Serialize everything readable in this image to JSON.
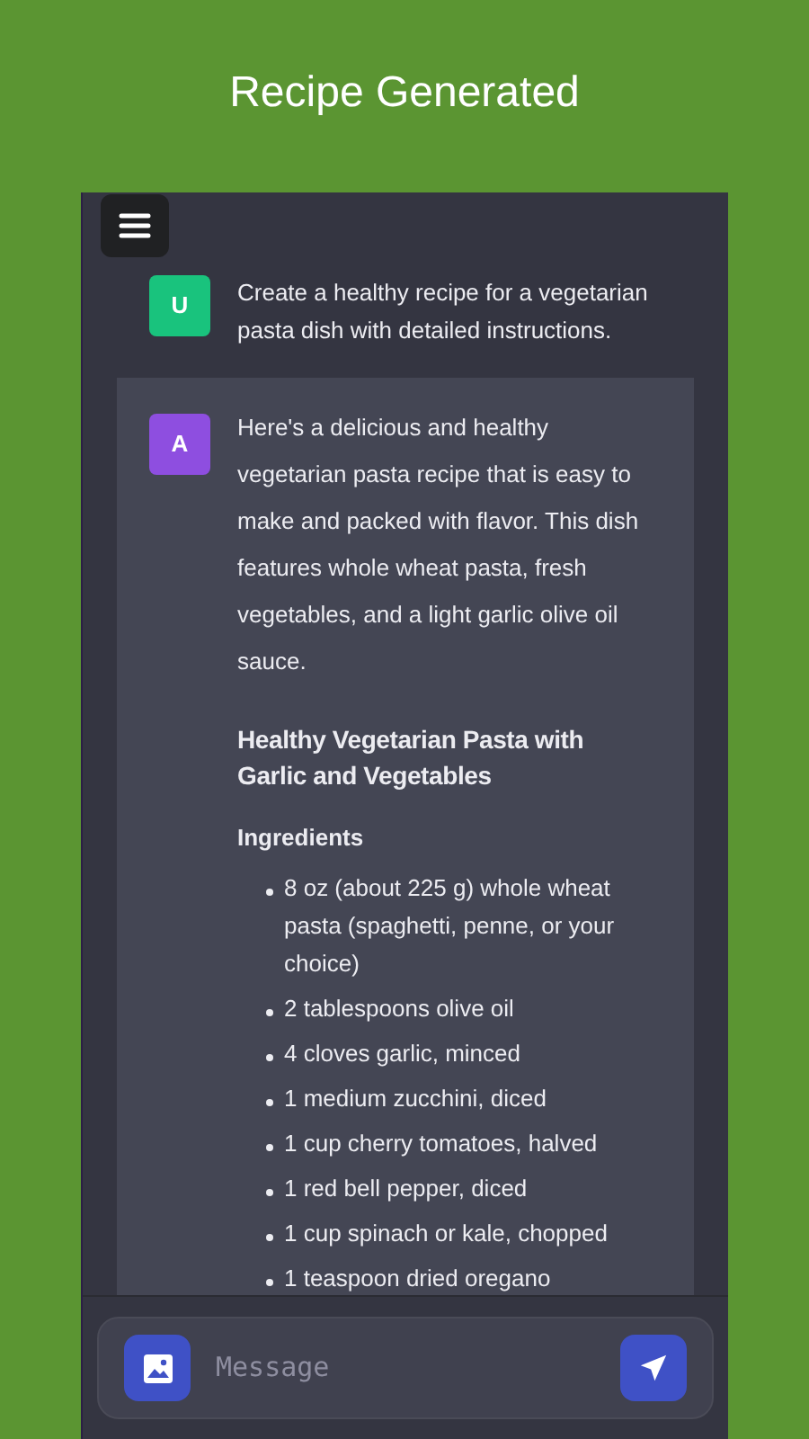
{
  "page_title": "Recipe Generated",
  "messages": [
    {
      "kind": "user",
      "avatar": "U",
      "color": "#19c37d",
      "blocks": [
        {
          "kind": "paragraph",
          "text": "Create a healthy recipe for a vegetarian pasta dish with detailed instructions."
        }
      ]
    },
    {
      "kind": "assistant",
      "avatar": "A",
      "color": "#8e4ee0",
      "blocks": [
        {
          "kind": "paragraph",
          "text": "Here's a delicious and healthy vegetarian pasta recipe that is easy to make and packed with flavor. This dish features whole wheat pasta, fresh vegetables, and a light garlic olive oil sauce."
        },
        {
          "kind": "heading",
          "text": "Healthy Vegetarian Pasta with Garlic and Vegetables"
        },
        {
          "kind": "subheading",
          "text": "Ingredients"
        },
        {
          "kind": "list",
          "items": [
            "8 oz (about 225 g) whole wheat pasta (spaghetti, penne, or your choice)",
            "2 tablespoons olive oil",
            "4 cloves garlic, minced",
            "1 medium zucchini, diced",
            "1 cup cherry tomatoes, halved",
            "1 red bell pepper, diced",
            "1 cup spinach or kale, chopped",
            "1 teaspoon dried oregano"
          ]
        }
      ]
    }
  ],
  "composer": {
    "placeholder": "Message"
  }
}
